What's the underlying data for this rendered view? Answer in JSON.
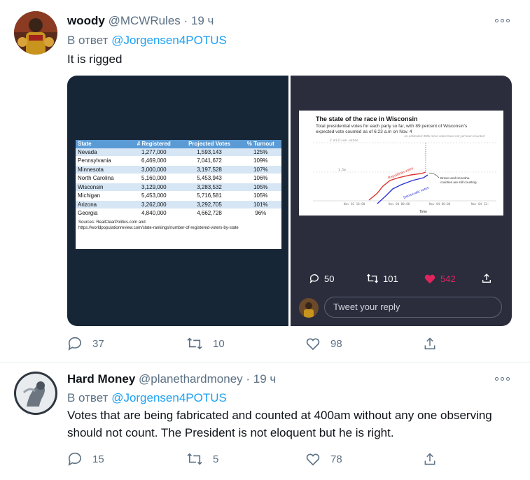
{
  "tweets": [
    {
      "name": "woody",
      "handle": "@MCWRules",
      "time": "· 19 ч",
      "reply_prefix": "В ответ",
      "reply_handle": "@Jorgensen4POTUS",
      "text": "It is rigged",
      "replies": "37",
      "retweets": "10",
      "likes": "98"
    },
    {
      "name": "Hard Money",
      "handle": "@planethardmoney",
      "time": "· 19 ч",
      "reply_prefix": "В ответ",
      "reply_handle": "@Jorgensen4POTUS",
      "text": "Votes that are being fabricated and counted at 400am without any one observing should not count.  The President is not eloquent but he is right.",
      "replies": "15",
      "retweets": "5",
      "likes": "78"
    }
  ],
  "table_image": {
    "headers": [
      "State",
      "# Registered",
      "Projected Votes",
      "% Turnout"
    ],
    "rows": [
      [
        "Nevada",
        "1,277,000",
        "1,593,143",
        "125%"
      ],
      [
        "Pennsylvania",
        "6,469,000",
        "7,041,672",
        "109%"
      ],
      [
        "Minnesota",
        "3,000,000",
        "3,197,528",
        "107%"
      ],
      [
        "North Carolina",
        "5,160,000",
        "5,453,943",
        "106%"
      ],
      [
        "Wisconsin",
        "3,129,000",
        "3,283,532",
        "105%"
      ],
      [
        "Michigan",
        "5,453,000",
        "5,716,581",
        "105%"
      ],
      [
        "Arizona",
        "3,262,000",
        "3,292,705",
        "101%"
      ],
      [
        "Georgia",
        "4,840,000",
        "4,662,728",
        "96%"
      ]
    ],
    "sources_line1": "Sources: RealClearPolitics.com and",
    "sources_line2": "https://worldpopulationreview.com/state-rankings/number-of-registered-voters-by-state"
  },
  "chart_image": {
    "title": "The state of the race in Wisconsin",
    "subtitle": "Total presidential votes for each party so far, with 89 percent of Wisconsin's expected vote counted as of 6:23 a.m on Nov. 4",
    "y_label_top": "2 million votes",
    "y_label_mid": "1.5m",
    "annotation_top": "An estimated 380k more votes have not yet been counted",
    "annotation_right": "Brown and Kenosha counties are still counting.",
    "series_red": "Republican votes",
    "series_blue": "Democratic votes",
    "x_ticks": [
      "Nov 03 18:00",
      "Nov 04 00:00",
      "Nov 04 06:00",
      "Nov 04 12:"
    ],
    "xlabel": "Time",
    "colors": {
      "red": "#e0312b",
      "blue": "#2b33d6"
    }
  },
  "inner_tweet": {
    "replies": "50",
    "retweets": "101",
    "likes": "542",
    "reply_placeholder": "Tweet your reply"
  }
}
